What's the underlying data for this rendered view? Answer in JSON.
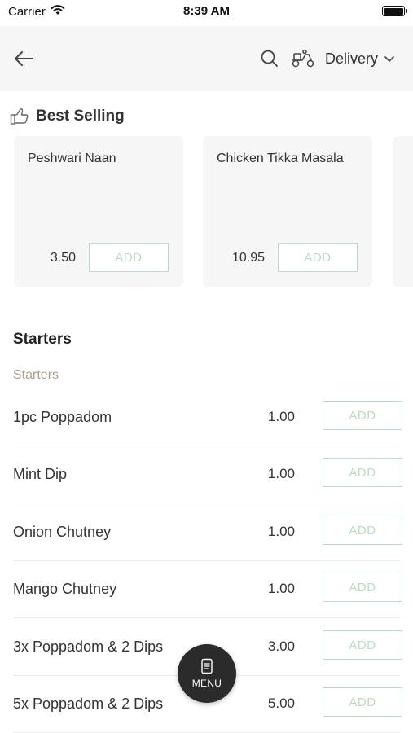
{
  "status_bar": {
    "carrier": "Carrier",
    "time": "8:39 AM"
  },
  "nav": {
    "delivery_label": "Delivery",
    "icons": [
      "back-arrow-icon",
      "search-icon",
      "scooter-icon",
      "chevron-down-icon"
    ]
  },
  "best_selling": {
    "title": "Best Selling",
    "icon": "thumbs-up-icon",
    "items": [
      {
        "name": "Peshwari Naan",
        "price": "3.50",
        "add_label": "ADD"
      },
      {
        "name": "Chicken Tikka Masala",
        "price": "10.95",
        "add_label": "ADD"
      }
    ]
  },
  "section": {
    "title": "Starters",
    "subtitle": "Starters",
    "items": [
      {
        "name": "1pc Poppadom",
        "price": "1.00",
        "add_label": "ADD"
      },
      {
        "name": "Mint Dip",
        "price": "1.00",
        "add_label": "ADD"
      },
      {
        "name": "Onion Chutney",
        "price": "1.00",
        "add_label": "ADD"
      },
      {
        "name": "Mango Chutney",
        "price": "1.00",
        "add_label": "ADD"
      },
      {
        "name": "3x Poppadom & 2 Dips",
        "price": "3.00",
        "add_label": "ADD"
      },
      {
        "name": "5x Poppadom & 2 Dips",
        "price": "5.00",
        "add_label": "ADD"
      }
    ]
  },
  "fab": {
    "label": "MENU",
    "icon": "menu-book-icon"
  },
  "colors": {
    "accent_green": "#b9dcc4",
    "subtitle_tan": "#ad9f86",
    "fab_dark": "#2b2b2b",
    "card_bg": "#f6f6f6"
  }
}
